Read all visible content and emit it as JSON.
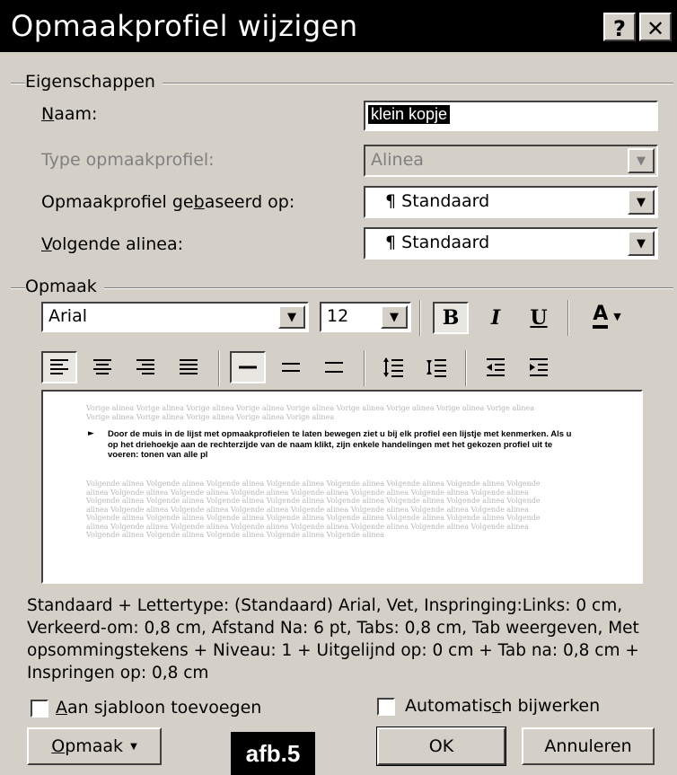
{
  "window": {
    "title": "Opmaakprofiel wijzigen",
    "help_label": "?",
    "close_label": "✕"
  },
  "properties": {
    "group_label": "Eigenschappen",
    "name_label_key": "N",
    "name_label_rest": "aam:",
    "name_value": "klein kopje",
    "type_label": "Type opmaakprofiel:",
    "type_value": "Alinea",
    "based_label_pre": "Opmaakprofiel ge",
    "based_label_key": "b",
    "based_label_post": "aseerd op:",
    "based_value": "¶ Standaard",
    "next_label_key": "V",
    "next_label_rest": "olgende alinea:",
    "next_value": "¶ Standaard"
  },
  "format": {
    "group_label": "Opmaak",
    "font_value": "Arial",
    "size_value": "12",
    "bold_label": "B",
    "italic_label": "I",
    "underline_label": "U",
    "font_color_label": "A"
  },
  "preview": {
    "prev_para": "Vorige alinea Vorige alinea Vorige alinea Vorige alinea Vorige alinea Vorige alinea Vorige alinea Vorige alinea Vorige alinea Vorige alinea Vorige alinea Vorige alinea Vorige alinea Vorige alinea",
    "sample": "Door de muis in de lijst met opmaakprofielen te laten bewegen ziet u bij elk profiel een lijstje met kenmerken. Als u op het driehoekje aan de rechterzijde van de naam klikt, zijn enkele handelingen met het gekozen profiel uit te voeren: tonen van alle pl",
    "next_para": "Volgende alinea Volgende alinea Volgende alinea Volgende alinea Volgende alinea Volgende alinea Volgende alinea Volgende alinea Volgende alinea Volgende alinea Volgende alinea Volgende alinea Volgende alinea Volgende alinea Volgende alinea Volgende alinea Volgende alinea Volgende alinea Volgende alinea Volgende alinea Volgende alinea Volgende alinea Volgende alinea Volgende alinea Volgende alinea Volgende alinea Volgende alinea Volgende alinea Volgende alinea Volgende alinea Volgende alinea Volgende alinea Volgende alinea Volgende alinea Volgende alinea Volgende alinea Volgende alinea Volgende alinea Volgende alinea Volgende alinea Volgende alinea Volgende alinea Volgende alinea Volgende alinea Volgende alinea Volgende alinea Volgende alinea Volgende alinea Volgende alinea Volgende alinea"
  },
  "description": "Standaard + Lettertype: (Standaard) Arial, Vet, Inspringing:Links:  0 cm, Verkeerd-om:  0,8 cm, Afstand Na:  6 pt, Tabs:  0,8 cm, Tab weergeven, Met opsommingstekens + Niveau: 1 + Uitgelijnd op:  0 cm + Tab na:  0,8 cm + Inspringen op:  0,8 cm",
  "options": {
    "add_template_key": "A",
    "add_template_rest": "an sjabloon toevoegen",
    "auto_update_pre": "Automatis",
    "auto_update_key": "c",
    "auto_update_post": "h bijwerken"
  },
  "buttons": {
    "format_key": "O",
    "format_rest": "pmaak",
    "ok": "OK",
    "cancel": "Annuleren"
  },
  "badge": "afb.5"
}
